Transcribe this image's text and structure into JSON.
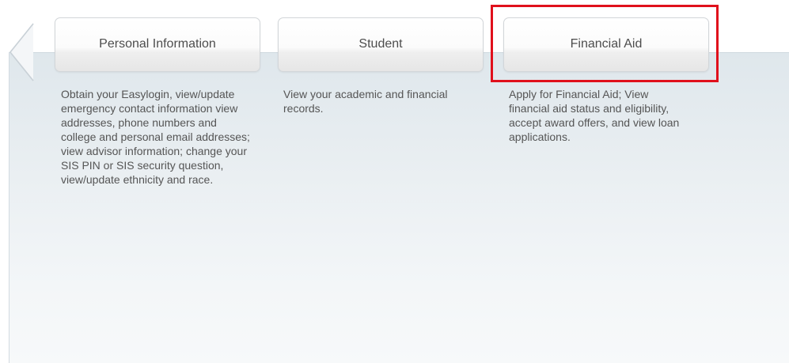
{
  "tabs": [
    {
      "label": "Personal Information",
      "description": "Obtain your Easylogin, view/update emergency contact information view addresses, phone numbers and college and personal email addresses; view advisor information; change your SIS PIN or SIS security question, view/update ethnicity and race."
    },
    {
      "label": "Student",
      "description": "View your academic and financial records."
    },
    {
      "label": "Financial Aid",
      "description": "Apply for Financial Aid; View financial aid status and eligibility, accept award offers, and view loan applications."
    }
  ],
  "icons": {
    "scroll_left": "chevron-left-icon"
  },
  "colors": {
    "highlight": "#e0101c",
    "text": "#555555",
    "tab_label": "#4d4d4d"
  }
}
